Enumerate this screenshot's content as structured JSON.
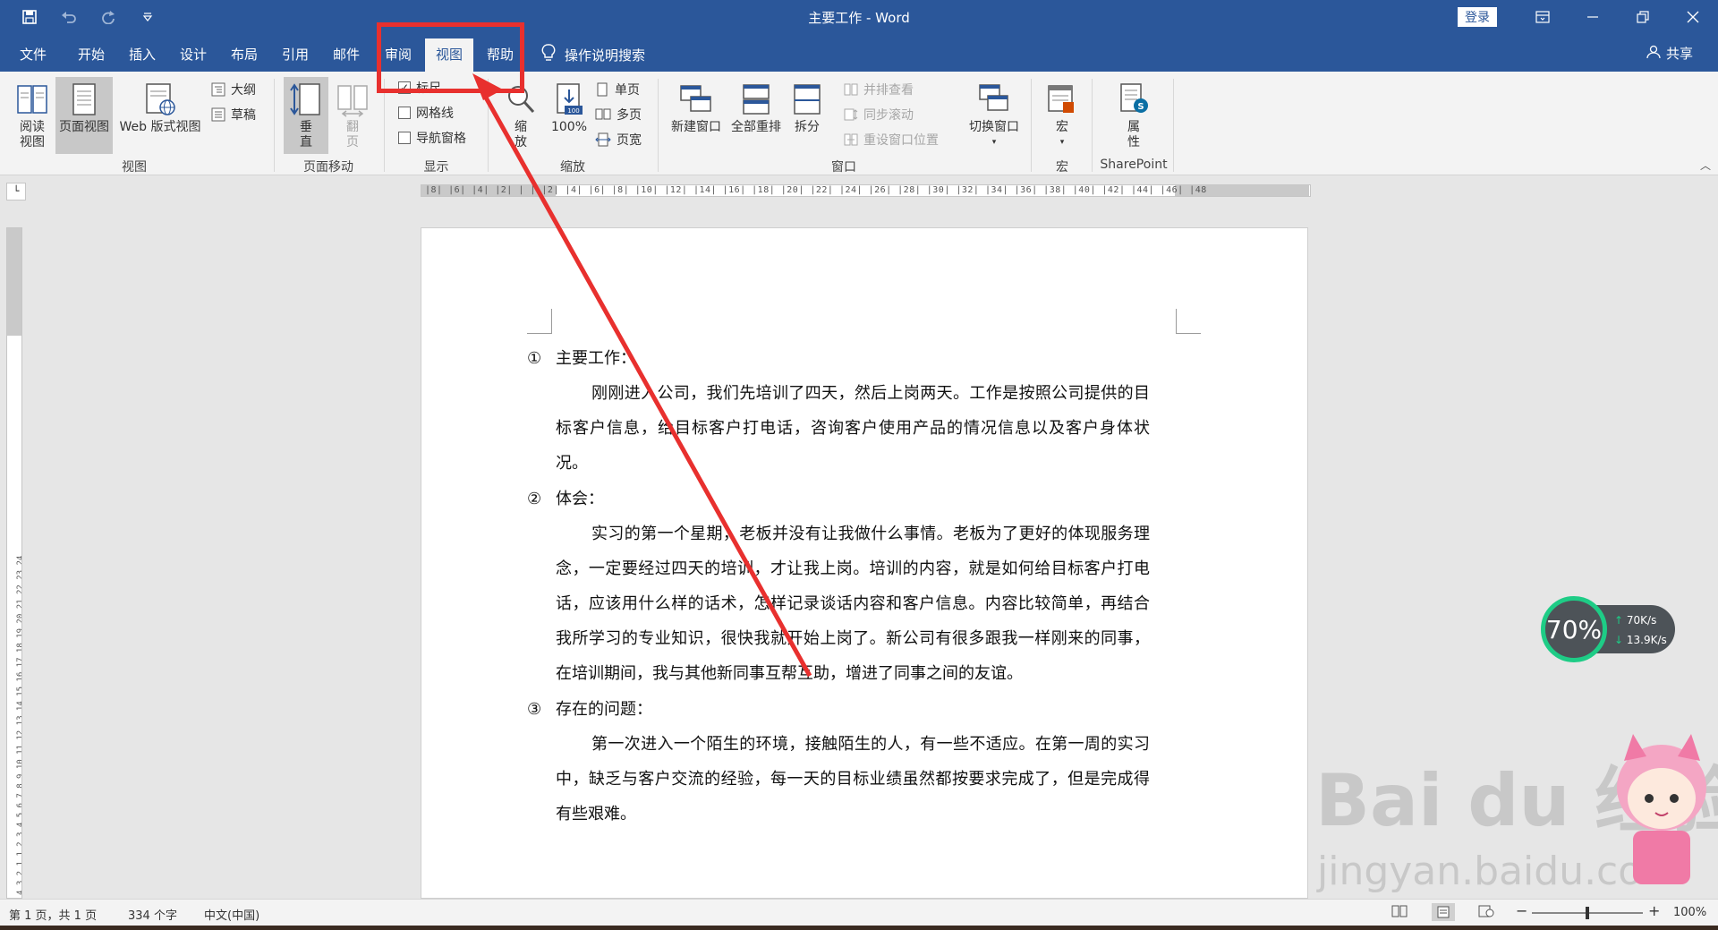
{
  "window": {
    "title": "主要工作 - Word",
    "login_label": "登录"
  },
  "tabs": [
    {
      "label": "文件",
      "active": false
    },
    {
      "label": "开始",
      "active": false
    },
    {
      "label": "插入",
      "active": false
    },
    {
      "label": "设计",
      "active": false
    },
    {
      "label": "布局",
      "active": false
    },
    {
      "label": "引用",
      "active": false
    },
    {
      "label": "邮件",
      "active": false
    },
    {
      "label": "审阅",
      "active": false
    },
    {
      "label": "视图",
      "active": true
    },
    {
      "label": "帮助",
      "active": false
    }
  ],
  "tell_me": "操作说明搜索",
  "share_label": "共享",
  "ribbon": {
    "views": {
      "read_mode": "阅读\n视图",
      "print_layout": "页面视图",
      "web_layout": "Web 版式视图",
      "outline": "大纲",
      "draft": "草稿",
      "group_label": "视图"
    },
    "page_movement": {
      "vertical": "垂\n直",
      "side_to_side": "翻\n页",
      "group_label": "页面移动"
    },
    "show": {
      "ruler": "标尺",
      "gridlines": "网格线",
      "nav_pane": "导航窗格",
      "group_label": "显示",
      "ruler_checked": true,
      "gridlines_checked": false,
      "nav_checked": false
    },
    "zoom": {
      "zoom": "缩\n放",
      "hundred": "100%",
      "one_page": "单页",
      "multi_page": "多页",
      "page_width": "页宽",
      "group_label": "缩放"
    },
    "window": {
      "new_window": "新建窗口",
      "arrange_all": "全部重排",
      "split": "拆分",
      "side_by_side": "并排查看",
      "sync_scroll": "同步滚动",
      "reset_position": "重设窗口位置",
      "switch_windows": "切换窗口",
      "group_label": "窗口"
    },
    "macros": {
      "macros": "宏",
      "group_label": "宏"
    },
    "sharepoint": {
      "properties": "属\n性",
      "group_label": "SharePoint"
    }
  },
  "ruler": {
    "h_numbers": "|8| |6| |4| |2| |  |  |2| |4| |6| |8| |10| |12| |14| |16| |18| |20| |22| |24| |26| |28| |30| |32| |34| |36| |38| |40| |42| |44| |46| |48",
    "v_numbers": "4 3 2 1   1 2 3 4 5 6 7 8 9 10 11 12 13 14 15 16 17 18 19 20 21 22 23 24"
  },
  "document": {
    "sections": [
      {
        "num": "①",
        "heading": "主要工作：",
        "paragraph": "刚刚进入公司，我们先培训了四天，然后上岗两天。工作是按照公司提供的目标客户信息，给目标客户打电话，咨询客户使用产品的情况信息以及客户身体状况。"
      },
      {
        "num": "②",
        "heading": "体会：",
        "paragraph": "实习的第一个星期，老板并没有让我做什么事情。老板为了更好的体现服务理念，一定要经过四天的培训，才让我上岗。培训的内容，就是如何给目标客户打电话，应该用什么样的话术，怎样记录谈话内容和客户信息。内容比较简单，再结合我所学习的专业知识，很快我就开始上岗了。新公司有很多跟我一样刚来的同事，在培训期间，我与其他新同事互帮互助，增进了同事之间的友谊。"
      },
      {
        "num": "③",
        "heading": "存在的问题：",
        "paragraph": "第一次进入一个陌生的环境，接触陌生的人，有一些不适应。在第一周的实习中，缺乏与客户交流的经验，每一天的目标业绩虽然都按要求完成了，但是完成得有些艰难。"
      }
    ]
  },
  "status": {
    "page": "第 1 页，共 1 页",
    "words": "334 个字",
    "language": "中文(中国)",
    "zoom": "100%"
  },
  "overlay": {
    "speed_percent": "70%",
    "up": "70K/s",
    "down": "13.9K/s",
    "watermark_main": "Bai du 经验",
    "watermark_url": "jingyan.baidu.com"
  },
  "colors": {
    "brand": "#2b579a",
    "annotation": "#e8302e",
    "speed_ring": "#1ecc86"
  }
}
